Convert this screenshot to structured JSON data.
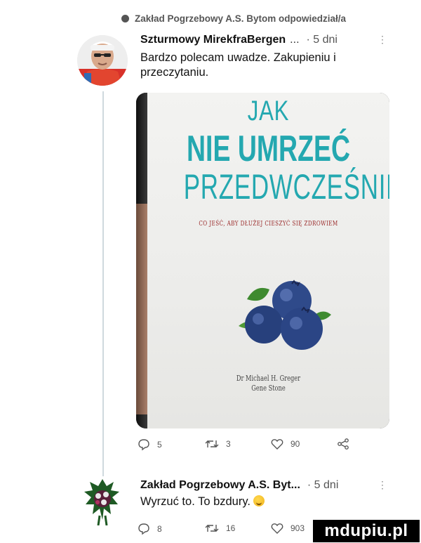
{
  "reply_context": "Zakład Pogrzebowy A.S. Bytom odpowiedział/a",
  "tweet1": {
    "author": "Szturmowy MirekfraBergen",
    "ellipsis": "...",
    "time": "· 5 dni",
    "more": "⋮",
    "text": "Bardzo polecam uwadze. Zakupieniu i przeczytaniu.",
    "book": {
      "line1": "JAK",
      "line2": "NIE UMRZEĆ",
      "line3": "PRZEDWCZEŚNIE",
      "subtitle": "CO JEŚĆ, ABY DŁUŻEJ CIESZYĆ SIĘ ZDROWIEM",
      "author1": "Dr Michael H. Greger",
      "author2": "Gene Stone"
    },
    "actions": {
      "replies": "5",
      "retweets": "3",
      "likes": "90"
    }
  },
  "tweet2": {
    "author": "Zakład Pogrzebowy A.S. Byt...",
    "time": "· 5 dni",
    "more": "⋮",
    "text": "Wyrzuć to. To bzdury.",
    "actions": {
      "replies": "8",
      "retweets": "16",
      "likes": "903"
    }
  },
  "watermark": "mdupiu.pl",
  "colors": {
    "book_title": "#24a8b0",
    "subtitle": "#9a2a2a",
    "blueberry": "#2f4a8a",
    "leaf": "#3e8a2f"
  },
  "icons": [
    "comment-bubble-icon",
    "reply-icon",
    "retweet-icon",
    "like-icon",
    "share-icon",
    "more-icon",
    "emoji-icon"
  ]
}
